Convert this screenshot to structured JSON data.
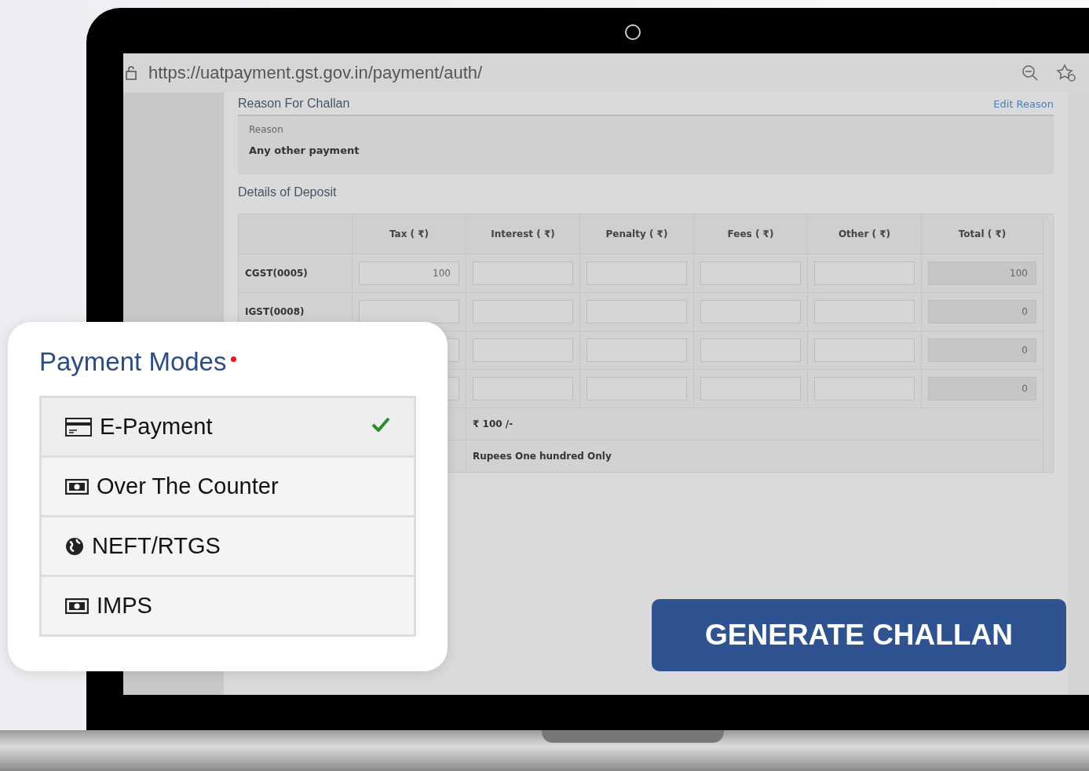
{
  "browser": {
    "url": "https://uatpayment.gst.gov.in/payment/auth/"
  },
  "reason_section": {
    "title": "Reason For Challan",
    "edit_link": "Edit Reason",
    "label": "Reason",
    "value": "Any other payment"
  },
  "deposit": {
    "title": "Details of Deposit",
    "columns": [
      "Tax ( ₹)",
      "Interest ( ₹)",
      "Penalty ( ₹)",
      "Fees ( ₹)",
      "Other ( ₹)",
      "Total ( ₹)"
    ],
    "rows": [
      {
        "label": "CGST(0005)",
        "tax": "100",
        "total": "100"
      },
      {
        "label": "IGST(0008)",
        "total": "0"
      },
      {
        "total": "0"
      },
      {
        "total": "0"
      }
    ],
    "total_amount": "₹ 100 /-",
    "total_words": "Rupees One hundred Only"
  },
  "payment_modes": {
    "title": "Payment Modes",
    "required": true,
    "items": [
      {
        "label": "E-Payment",
        "kind": "card",
        "selected": true
      },
      {
        "label": "Over The Counter",
        "kind": "cash",
        "selected": false
      },
      {
        "label": "NEFT/RTGS",
        "kind": "globe",
        "selected": false
      },
      {
        "label": "IMPS",
        "kind": "cash",
        "selected": false
      }
    ]
  },
  "generate_button": "GENERATE CHALLAN"
}
